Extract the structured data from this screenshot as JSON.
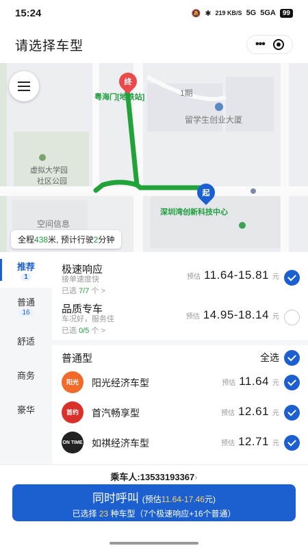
{
  "status_bar": {
    "time": "15:24",
    "net_speed": "219 KB/S",
    "signal_1": "5G",
    "signal_2": "5GA",
    "battery": "99"
  },
  "title_bar": {
    "title": "请选择车型",
    "more_icon": "more-dots-icon",
    "close_icon": "target-circle-icon"
  },
  "map": {
    "labels": {
      "end_station": "粤海门[地铁站]",
      "phase": "1期",
      "building": "留学生创业大厦",
      "park_1": "虚拟大学园",
      "park_2": "社区公园",
      "start_place": "深圳湾创新科技中心",
      "info": "空间信息"
    },
    "end_marker": "终",
    "start_marker": "起",
    "route_info": {
      "prefix": "全程",
      "distance": "438",
      "middle": "米, 预计行驶",
      "minutes": "2",
      "suffix": "分钟"
    },
    "route_color": "#22a33a"
  },
  "sidebar": {
    "items": [
      {
        "label": "推荐",
        "count": "1"
      },
      {
        "label": "普通",
        "count": "16"
      },
      {
        "label": "舒适"
      },
      {
        "label": "商务"
      },
      {
        "label": "豪华"
      }
    ]
  },
  "services": [
    {
      "name": "极速响应",
      "sub": "接单速度快",
      "sel_prefix": "已选",
      "sel_count": "7/7",
      "sel_suffix": "个 >",
      "est": "预估",
      "price": "11.64-15.81",
      "unit": "元",
      "checked": true
    },
    {
      "name": "品质专车",
      "sub": "车况好，服务佳",
      "sel_prefix": "已选",
      "sel_count": "0/5",
      "sel_suffix": "个 >",
      "est": "预估",
      "price": "14.95-18.14",
      "unit": "元",
      "checked": false
    }
  ],
  "group": {
    "name": "普通型",
    "select_all": "全选"
  },
  "cars": [
    {
      "logo": "阳光",
      "logo_color": "#f06a2a",
      "name": "阳光经济车型",
      "est": "预估",
      "price": "11.64",
      "unit": "元"
    },
    {
      "logo": "首约",
      "logo_color": "#d9302c",
      "name": "首汽畅享型",
      "est": "预估",
      "price": "12.61",
      "unit": "元"
    },
    {
      "logo": "ON TIME",
      "logo_color": "#222222",
      "name": "如祺经济车型",
      "est": "预估",
      "price": "12.71",
      "unit": "元"
    }
  ],
  "footer": {
    "passenger_label": "乘车人:",
    "passenger_phone": "13533193367",
    "call_label": "同时呼叫",
    "call_est_prefix": "(预估",
    "call_est_range": "11.64-17.46",
    "call_est_suffix": "元)",
    "selected_prefix": "已选择",
    "selected_count": "23",
    "selected_suffix": "种车型（7个极速响应+16个普通）"
  },
  "colors": {
    "accent": "#1b5fd1",
    "highlight": "#ffd35a",
    "green": "#1d9d3c"
  }
}
